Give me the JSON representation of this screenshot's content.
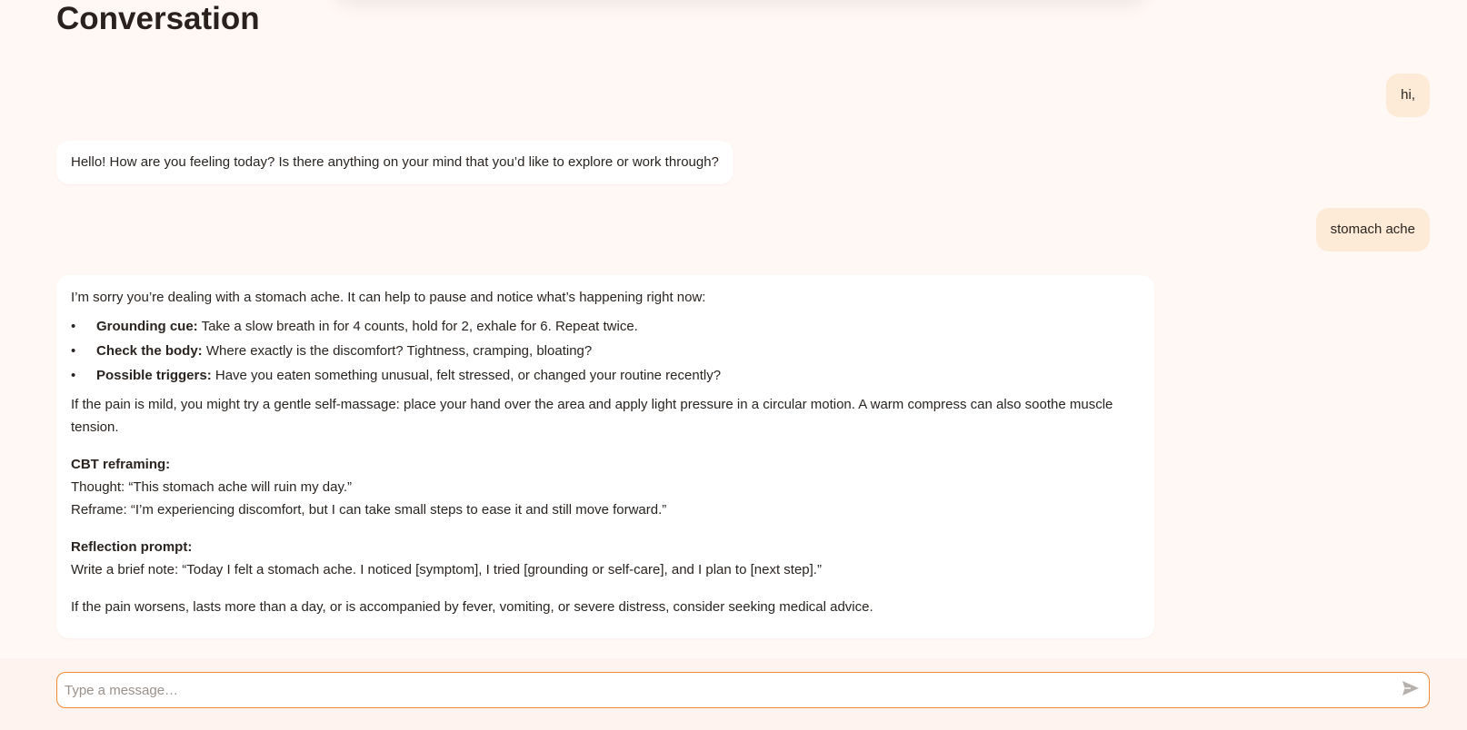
{
  "page": {
    "title": "Conversation"
  },
  "messages": [
    {
      "role": "user",
      "text": "hi,"
    },
    {
      "role": "assistant",
      "text": "Hello! How are you feeling today? Is there anything on your mind that you’d like to explore or work through?"
    },
    {
      "role": "user",
      "text": "stomach ache"
    },
    {
      "role": "assistant",
      "intro": "I’m sorry you’re dealing with a stomach ache. It can help to pause and notice what’s happening right now:",
      "bullets": [
        {
          "label": "Grounding cue:",
          "text": " Take a slow breath in for 4 counts, hold for 2, exhale for 6. Repeat twice."
        },
        {
          "label": "Check the body:",
          "text": " Where exactly is the discomfort? Tightness, cramping, bloating?"
        },
        {
          "label": "Possible triggers:",
          "text": " Have you eaten something unusual, felt stressed, or changed your routine recently?"
        }
      ],
      "para1": "If the pain is mild, you might try a gentle self-massage: place your hand over the area and apply light pressure in a circular motion. A warm compress can also soothe muscle tension.",
      "cbt_heading": "CBT reframing:",
      "cbt_thought": "Thought: “This stomach ache will ruin my day.”",
      "cbt_reframe": "Reframe: “I’m experiencing discomfort, but I can take small steps to ease it and still move forward.”",
      "reflection_heading": "Reflection prompt:",
      "reflection_text": "Write a brief note: “Today I felt a stomach ache. I noticed [symptom], I tried [grounding or self-care], and I plan to [next step].”",
      "closing": "If the pain worsens, lasts more than a day, or is accompanied by fever, vomiting, or severe distress, consider seeking medical advice."
    }
  ],
  "composer": {
    "placeholder": "Type a message…",
    "value": "",
    "send_icon": "send-icon"
  },
  "colors": {
    "background": "#fff8f5",
    "user_bubble": "#fdebd8",
    "assistant_bubble": "#ffffff",
    "input_border": "#f08a34"
  }
}
